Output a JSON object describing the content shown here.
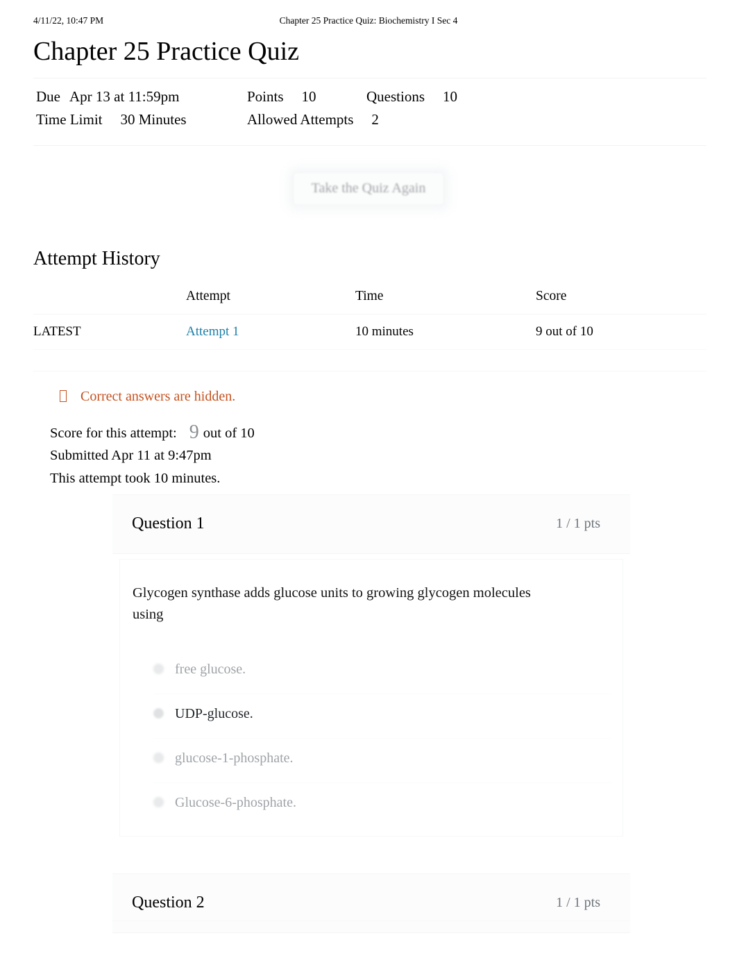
{
  "print_header": {
    "date": "4/11/22, 10:47 PM",
    "title": "Chapter 25 Practice Quiz: Biochemistry I Sec 4"
  },
  "page_title": "Chapter 25 Practice Quiz",
  "quiz_details": {
    "due_label": "Due",
    "due_value": "Apr 13 at 11:59pm",
    "points_label": "Points",
    "points_value": "10",
    "questions_label": "Questions",
    "questions_value": "10",
    "time_limit_label": "Time Limit",
    "time_limit_value": "30 Minutes",
    "allowed_attempts_label": "Allowed Attempts",
    "allowed_attempts_value": "2"
  },
  "retake_button": {
    "label": "Take the Quiz Again"
  },
  "attempt_history": {
    "section_title": "Attempt History",
    "columns": [
      "",
      "Attempt",
      "Time",
      "Score"
    ],
    "rows": [
      {
        "marker": "LATEST",
        "attempt": "Attempt 1",
        "time": "10 minutes",
        "score": "9 out of 10"
      }
    ]
  },
  "hidden_notice": {
    "text": "Correct answers are hidden.",
    "color": "#c5511e"
  },
  "score_summary": {
    "score_label": "Score for this attempt:",
    "score_value": "9",
    "score_suffix": "out of 10",
    "submitted": "Submitted Apr 11 at 9:47pm",
    "duration": "This attempt took 10 minutes."
  },
  "questions": [
    {
      "name": "Question 1",
      "points": "1 / 1 pts",
      "text": "Glycogen synthase adds glucose units to growing glycogen molecules using",
      "answers": [
        {
          "label": "free glucose.",
          "selected": false
        },
        {
          "label": "UDP-glucose.",
          "selected": true
        },
        {
          "label": "glucose-1-phosphate.",
          "selected": false
        },
        {
          "label": "Glucose-6-phosphate.",
          "selected": false
        }
      ]
    },
    {
      "name": "Question 2",
      "points": "1 / 1 pts",
      "text": "",
      "answers": []
    }
  ],
  "colors": {
    "link": "#1a7fa8",
    "warning": "#c5511e",
    "muted": "#9fa4a8",
    "page_text": "#000000"
  }
}
